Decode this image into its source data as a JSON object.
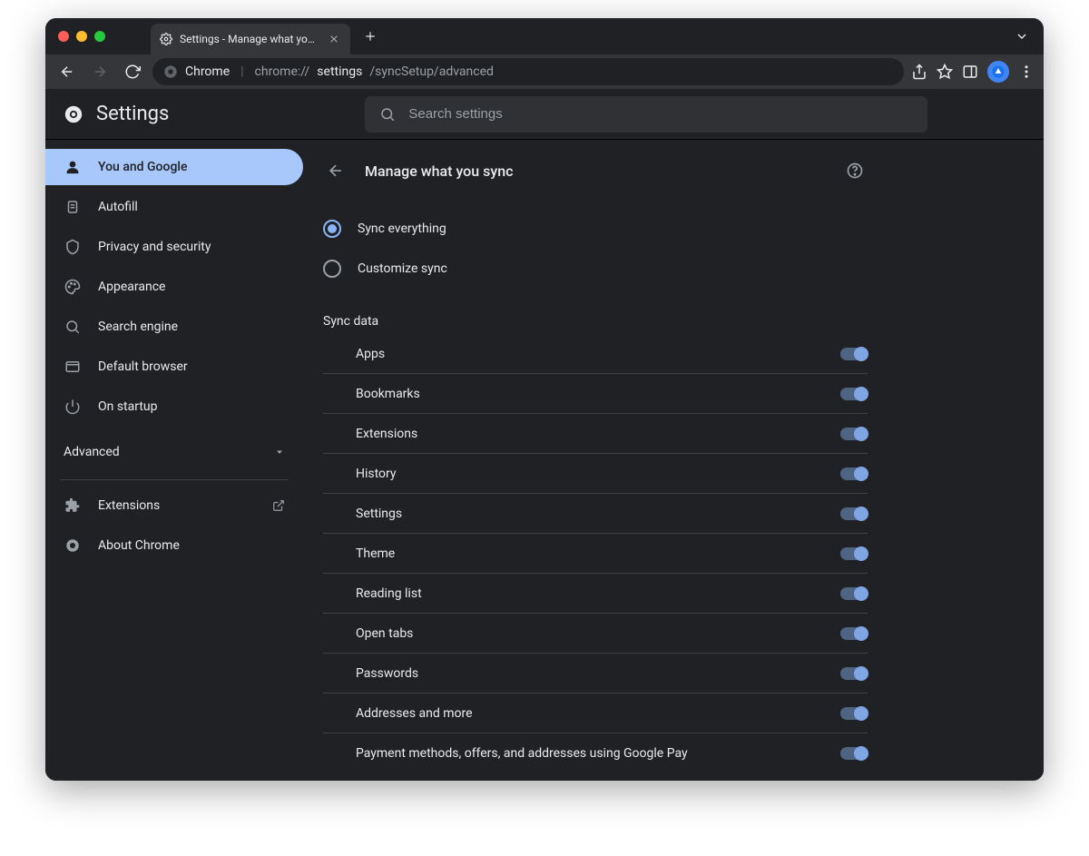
{
  "tab": {
    "title": "Settings - Manage what you sy"
  },
  "url": {
    "scheme_label": "Chrome",
    "prefix": "chrome://",
    "path1": "settings",
    "path2": "/syncSetup/advanced"
  },
  "settings_header": {
    "title": "Settings",
    "search_placeholder": "Search settings"
  },
  "sidebar": {
    "items": [
      {
        "label": "You and Google"
      },
      {
        "label": "Autofill"
      },
      {
        "label": "Privacy and security"
      },
      {
        "label": "Appearance"
      },
      {
        "label": "Search engine"
      },
      {
        "label": "Default browser"
      },
      {
        "label": "On startup"
      }
    ],
    "advanced_label": "Advanced",
    "extensions_label": "Extensions",
    "about_label": "About Chrome"
  },
  "page": {
    "title": "Manage what you sync",
    "radio_sync_everything": "Sync everything",
    "radio_customize": "Customize sync",
    "section_label": "Sync data",
    "items": [
      {
        "label": "Apps",
        "on": true
      },
      {
        "label": "Bookmarks",
        "on": true
      },
      {
        "label": "Extensions",
        "on": true
      },
      {
        "label": "History",
        "on": true
      },
      {
        "label": "Settings",
        "on": true
      },
      {
        "label": "Theme",
        "on": true
      },
      {
        "label": "Reading list",
        "on": true
      },
      {
        "label": "Open tabs",
        "on": true
      },
      {
        "label": "Passwords",
        "on": true
      },
      {
        "label": "Addresses and more",
        "on": true
      },
      {
        "label": "Payment methods, offers, and addresses using Google Pay",
        "on": true
      }
    ]
  }
}
